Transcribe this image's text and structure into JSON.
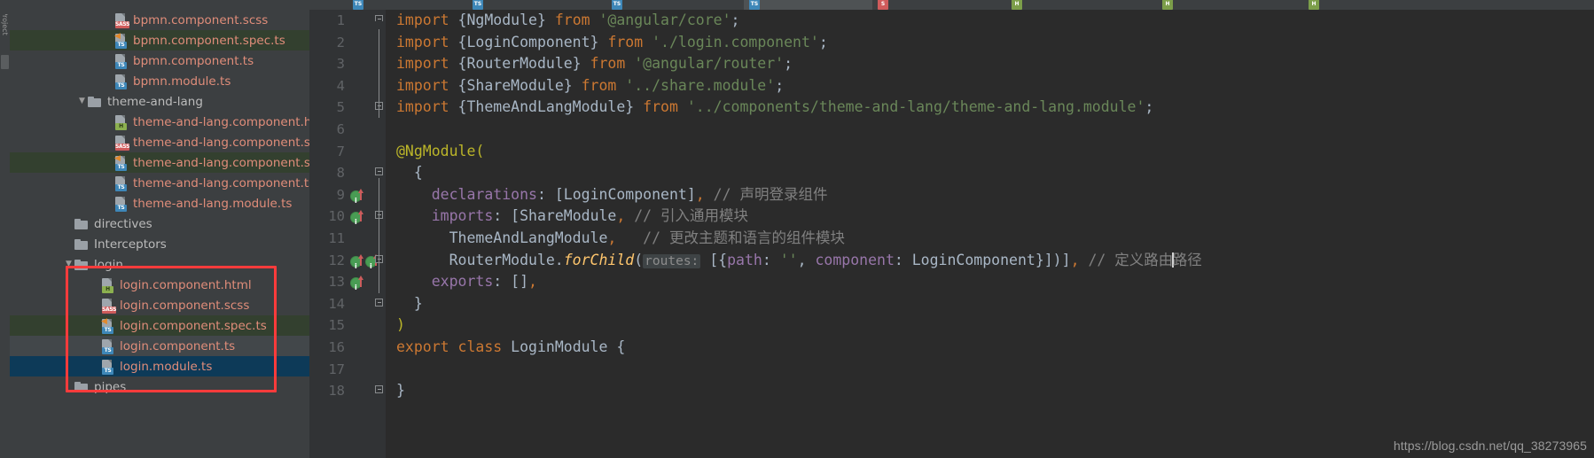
{
  "window": {
    "background": "#3c3f41",
    "editor_background": "#2b2b2b",
    "accent": "#26a0c8",
    "annotation_color": "#ff3b3b",
    "selection_color": "#0d3a58",
    "modified_color": "#33402f"
  },
  "rail": {
    "label": "1: Project",
    "thumb_name": "scrollbar-thumb"
  },
  "tabs": [
    {
      "label": "",
      "icon": "ts-file-icon",
      "icon_kind": "ts",
      "active": false
    },
    {
      "label": "",
      "icon": "ts-file-icon",
      "icon_kind": "ts",
      "active": false
    },
    {
      "label": "",
      "icon": "ts-file-icon",
      "icon_kind": "ts",
      "active": false
    },
    {
      "label": "",
      "icon": "ts-file-icon",
      "icon_kind": "ts",
      "active": true
    },
    {
      "label": "",
      "icon": "scss-file-icon",
      "icon_kind": "scss",
      "active": false
    },
    {
      "label": "",
      "icon": "html-file-icon",
      "icon_kind": "html",
      "active": false
    },
    {
      "label": "",
      "icon": "html-file-icon",
      "icon_kind": "html",
      "active": false
    },
    {
      "label": "",
      "icon": "html-file-icon",
      "icon_kind": "html",
      "active": false
    }
  ],
  "tree": {
    "items": [
      {
        "name": "bpmn.component.scss",
        "type": "file",
        "badge": "SASS",
        "badge_kind": "scss",
        "indent": 7,
        "spec": false,
        "state": "none"
      },
      {
        "name": "bpmn.component.spec.ts",
        "type": "file",
        "badge": "TS",
        "badge_kind": "ts",
        "indent": 7,
        "spec": true,
        "state": "modified"
      },
      {
        "name": "bpmn.component.ts",
        "type": "file",
        "badge": "TS",
        "badge_kind": "ts",
        "indent": 7,
        "spec": false,
        "state": "none"
      },
      {
        "name": "bpmn.module.ts",
        "type": "file",
        "badge": "TS",
        "badge_kind": "ts",
        "indent": 7,
        "spec": false,
        "state": "none"
      },
      {
        "name": "theme-and-lang",
        "type": "folder",
        "indent": 5,
        "arrow": "down",
        "state": "none"
      },
      {
        "name": "theme-and-lang.component.html",
        "type": "file",
        "badge": "H",
        "badge_kind": "html",
        "indent": 7,
        "spec": false,
        "state": "none"
      },
      {
        "name": "theme-and-lang.component.scss",
        "type": "file",
        "badge": "SASS",
        "badge_kind": "scss",
        "indent": 7,
        "spec": false,
        "state": "none"
      },
      {
        "name": "theme-and-lang.component.spec.ts",
        "type": "file",
        "badge": "TS",
        "badge_kind": "ts",
        "indent": 7,
        "spec": true,
        "state": "modified"
      },
      {
        "name": "theme-and-lang.component.ts",
        "type": "file",
        "badge": "TS",
        "badge_kind": "ts",
        "indent": 7,
        "spec": false,
        "state": "none"
      },
      {
        "name": "theme-and-lang.module.ts",
        "type": "file",
        "badge": "TS",
        "badge_kind": "ts",
        "indent": 7,
        "spec": false,
        "state": "none"
      },
      {
        "name": "directives",
        "type": "folder",
        "indent": 4,
        "arrow": "none",
        "state": "none"
      },
      {
        "name": "Interceptors",
        "type": "folder",
        "indent": 4,
        "arrow": "none",
        "state": "none"
      },
      {
        "name": "login",
        "type": "folder",
        "indent": 4,
        "arrow": "down",
        "state": "none"
      },
      {
        "name": "login.component.html",
        "type": "file",
        "badge": "H",
        "badge_kind": "html",
        "indent": 6,
        "spec": false,
        "state": "none"
      },
      {
        "name": "login.component.scss",
        "type": "file",
        "badge": "SASS",
        "badge_kind": "scss",
        "indent": 6,
        "spec": false,
        "state": "none"
      },
      {
        "name": "login.component.spec.ts",
        "type": "file",
        "badge": "TS",
        "badge_kind": "ts",
        "indent": 6,
        "spec": true,
        "state": "modified"
      },
      {
        "name": "login.component.ts",
        "type": "file",
        "badge": "TS",
        "badge_kind": "ts",
        "indent": 6,
        "spec": false,
        "state": "hover"
      },
      {
        "name": "login.module.ts",
        "type": "file",
        "badge": "TS",
        "badge_kind": "ts",
        "indent": 6,
        "spec": false,
        "state": "selected"
      },
      {
        "name": "pipes",
        "type": "folder",
        "indent": 4,
        "arrow": "none",
        "state": "none"
      }
    ]
  },
  "editor": {
    "lines": [
      {
        "no": "1",
        "segments": [
          {
            "t": "import ",
            "c": "kw"
          },
          {
            "t": "{NgModule} ",
            "c": "cls"
          },
          {
            "t": "from ",
            "c": "kw"
          },
          {
            "t": "'@angular/core'",
            "c": "str"
          },
          {
            "t": ";",
            "c": "pn"
          }
        ]
      },
      {
        "no": "2",
        "segments": [
          {
            "t": "import ",
            "c": "kw"
          },
          {
            "t": "{LoginComponent} ",
            "c": "cls"
          },
          {
            "t": "from ",
            "c": "kw"
          },
          {
            "t": "'./login.component'",
            "c": "str"
          },
          {
            "t": ";",
            "c": "pn"
          }
        ]
      },
      {
        "no": "3",
        "segments": [
          {
            "t": "import ",
            "c": "kw"
          },
          {
            "t": "{RouterModule} ",
            "c": "cls"
          },
          {
            "t": "from ",
            "c": "kw"
          },
          {
            "t": "'@angular/router'",
            "c": "str"
          },
          {
            "t": ";",
            "c": "pn"
          }
        ]
      },
      {
        "no": "4",
        "segments": [
          {
            "t": "import ",
            "c": "kw"
          },
          {
            "t": "{ShareModule} ",
            "c": "cls"
          },
          {
            "t": "from ",
            "c": "kw"
          },
          {
            "t": "'../share.module'",
            "c": "str"
          },
          {
            "t": ";",
            "c": "pn"
          }
        ]
      },
      {
        "no": "5",
        "segments": [
          {
            "t": "import ",
            "c": "kw"
          },
          {
            "t": "{ThemeAndLangModule} ",
            "c": "cls"
          },
          {
            "t": "from ",
            "c": "kw"
          },
          {
            "t": "'../components/theme-and-lang/theme-and-lang.module'",
            "c": "str"
          },
          {
            "t": ";",
            "c": "pn"
          }
        ]
      },
      {
        "no": "6",
        "segments": []
      },
      {
        "no": "7",
        "segments": [
          {
            "t": "@NgModule(",
            "c": "ann"
          }
        ]
      },
      {
        "no": "8",
        "segments": [
          {
            "t": "  {",
            "c": "pn"
          }
        ]
      },
      {
        "no": "9",
        "segments": [
          {
            "t": "    ",
            "c": "pn"
          },
          {
            "t": "declarations",
            "c": "prop"
          },
          {
            "t": ": [LoginComponent]",
            "c": "cls"
          },
          {
            "t": ",",
            "c": "kw"
          },
          {
            "t": " ",
            "c": "pn"
          },
          {
            "t": "// 声明登录组件",
            "c": "com"
          }
        ]
      },
      {
        "no": "10",
        "segments": [
          {
            "t": "    ",
            "c": "pn"
          },
          {
            "t": "imports",
            "c": "prop"
          },
          {
            "t": ": [ShareModule",
            "c": "cls"
          },
          {
            "t": ",",
            "c": "kw"
          },
          {
            "t": " ",
            "c": "pn"
          },
          {
            "t": "// 引入通用模块",
            "c": "com"
          }
        ]
      },
      {
        "no": "11",
        "segments": [
          {
            "t": "      ThemeAndLangModule",
            "c": "cls"
          },
          {
            "t": ",",
            "c": "kw"
          },
          {
            "t": "   ",
            "c": "pn"
          },
          {
            "t": "// 更改主题和语言的组件模块",
            "c": "com"
          }
        ]
      },
      {
        "no": "12",
        "segments": [
          {
            "t": "      RouterModule.",
            "c": "cls"
          },
          {
            "t": "forChild",
            "c": "fn"
          },
          {
            "t": "(",
            "c": "pn"
          },
          {
            "t": "routes:",
            "c": "hint"
          },
          {
            "t": " [{",
            "c": "cls"
          },
          {
            "t": "path",
            "c": "prop"
          },
          {
            "t": ": ",
            "c": "cls"
          },
          {
            "t": "''",
            "c": "str"
          },
          {
            "t": ", ",
            "c": "cls"
          },
          {
            "t": "component",
            "c": "prop"
          },
          {
            "t": ": LoginComponent}])",
            "c": "cls"
          },
          {
            "t": "]",
            "c": "cls"
          },
          {
            "t": ",",
            "c": "kw"
          },
          {
            "t": " ",
            "c": "pn"
          },
          {
            "t": "// 定义路由",
            "c": "com"
          },
          {
            "t": "|CARET|",
            "c": "caret"
          },
          {
            "t": "路径",
            "c": "com"
          }
        ]
      },
      {
        "no": "13",
        "segments": [
          {
            "t": "    ",
            "c": "pn"
          },
          {
            "t": "exports",
            "c": "prop"
          },
          {
            "t": ": []",
            "c": "cls"
          },
          {
            "t": ",",
            "c": "kw"
          }
        ]
      },
      {
        "no": "14",
        "segments": [
          {
            "t": "  }",
            "c": "pn"
          }
        ]
      },
      {
        "no": "15",
        "segments": [
          {
            "t": ")",
            "c": "ann"
          }
        ]
      },
      {
        "no": "16",
        "segments": [
          {
            "t": "export ",
            "c": "kw"
          },
          {
            "t": "class ",
            "c": "kw"
          },
          {
            "t": "LoginModule ",
            "c": "cls"
          },
          {
            "t": "{",
            "c": "pn"
          }
        ]
      },
      {
        "no": "17",
        "segments": []
      },
      {
        "no": "18",
        "segments": [
          {
            "t": "}",
            "c": "pn"
          }
        ]
      }
    ],
    "run_markers": [
      {
        "line_index": 8,
        "count": 1
      },
      {
        "line_index": 9,
        "count": 1
      },
      {
        "line_index": 11,
        "count": 2
      },
      {
        "line_index": 12,
        "count": 1
      }
    ]
  },
  "watermark": {
    "text": "https://blog.csdn.net/qq_38273965"
  }
}
